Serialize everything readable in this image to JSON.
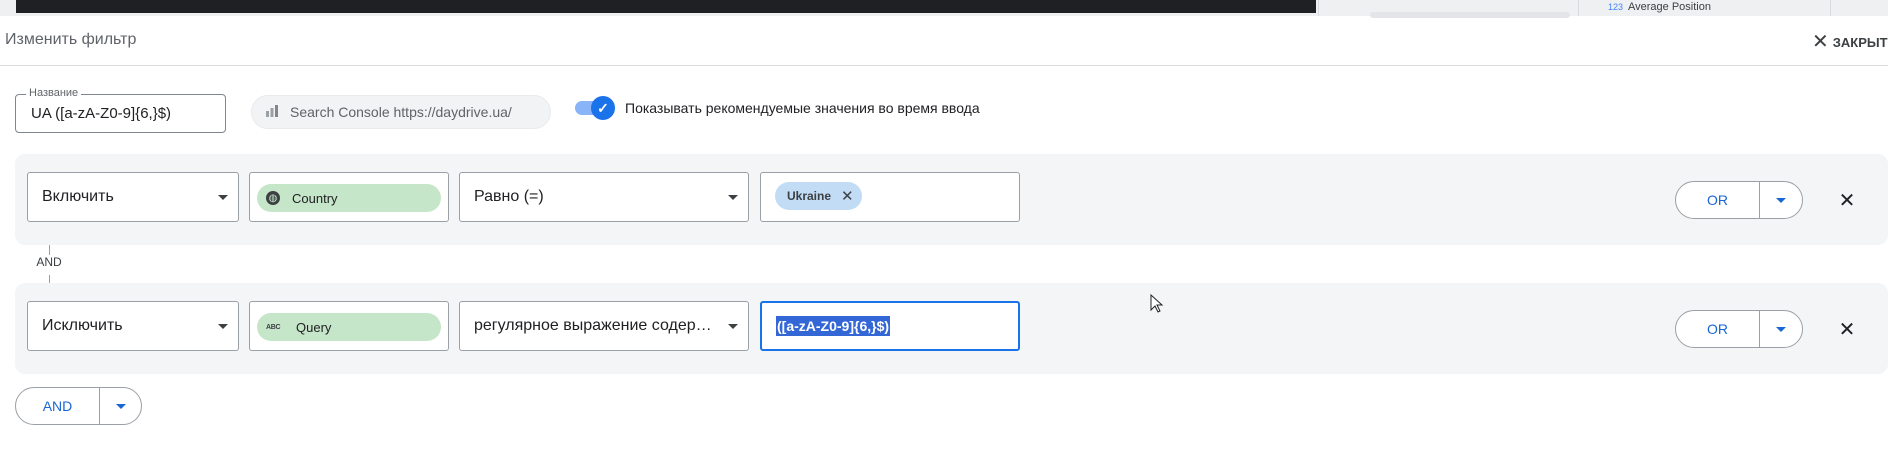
{
  "background_panel": {
    "metric_index": "123",
    "metric_label": "Average Position"
  },
  "header": {
    "title": "Изменить фильтр",
    "close_icon": "close-icon",
    "close_label": "ЗАКРЫТЬ"
  },
  "name_field": {
    "label": "Название",
    "value": "UA ([a-zA-Z0-9]{6,}$)"
  },
  "data_source": {
    "icon": "search-console-icon",
    "label": "Search Console https://daydrive.ua/"
  },
  "suggestions_toggle": {
    "checked": true,
    "label": "Показывать рекомендуемые значения во время ввода"
  },
  "conditions": [
    {
      "mode": "Включить",
      "dimension": "Country",
      "dimension_icon": "globe-icon",
      "operator": "Равно (=)",
      "value_chip": "Ukraine",
      "or_label": "OR"
    },
    {
      "mode": "Исключить",
      "dimension": "Query",
      "dimension_icon": "text-abc-icon",
      "dimension_icon_text": "ABC",
      "operator": "регулярное выражение содержит",
      "value_text": "([a-zA-Z0-9]{6,}$)",
      "or_label": "OR"
    }
  ],
  "connector_label": "AND",
  "add_and_label": "AND",
  "colors": {
    "accent": "#1a73e8",
    "dimension_chip": "#c6e6c9",
    "value_chip": "#c2dcf5",
    "row_background": "#f4f5f6"
  }
}
